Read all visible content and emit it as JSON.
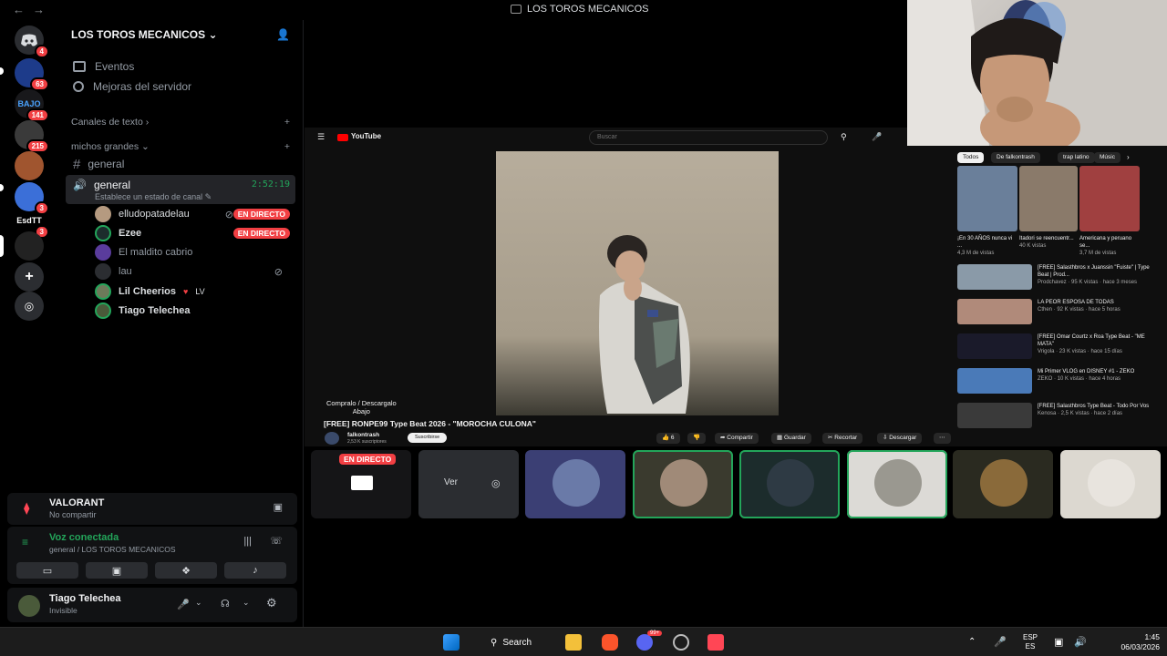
{
  "window": {
    "title": "LOS TOROS MECANICOS"
  },
  "rail": {
    "servers": [
      {
        "name": "discord-home-icon",
        "badge": "4"
      },
      {
        "name": "server-1",
        "badge": "63"
      },
      {
        "name": "server-bajo",
        "label": "BAJO",
        "badge": "141"
      },
      {
        "name": "server-3",
        "badge": "215"
      },
      {
        "name": "server-4",
        "badge": ""
      },
      {
        "name": "server-5",
        "badge": "3"
      },
      {
        "name": "server-esdtt",
        "label": "EsdTT",
        "badge": "3"
      },
      {
        "name": "server-toros",
        "badge": ""
      }
    ]
  },
  "sidebar": {
    "server_name": "LOS TOROS MECANICOS",
    "events": "Eventos",
    "boosts": "Mejoras del servidor",
    "category_text": "Canales de texto",
    "category_voice": "michos grandes",
    "text_channel": "general",
    "voice_channel": "general",
    "voice_timer": "2:52:19",
    "voice_status": "Establece un estado de canal",
    "users": [
      {
        "name": "elludopatadelau",
        "live": "EN DIRECTO"
      },
      {
        "name": "Ezee",
        "live": "EN DIRECTO"
      },
      {
        "name": "El maldito cabrio",
        "live": ""
      },
      {
        "name": "lau",
        "live": ""
      },
      {
        "name": "Lil Cheerios",
        "live": "",
        "extra": "LV"
      },
      {
        "name": "Tiago Telechea",
        "live": ""
      }
    ]
  },
  "activity": {
    "game": "VALORANT",
    "status": "No compartir"
  },
  "voice": {
    "state": "Voz conectada",
    "location": "general / LOS TOROS MECANICOS"
  },
  "account": {
    "name": "Tiago Telechea",
    "status": "Invisible"
  },
  "youtube": {
    "logo": "YouTube",
    "search_placeholder": "Buscar",
    "chips": [
      "Todos",
      "De falkontrash",
      "trap latino",
      "Músic"
    ],
    "overlay_text": "Compralo / Descargalo\nAbajo",
    "video_title": "[FREE] RONPE99 Type Beat 2026 - \"MOROCHA CULONA\"",
    "channel": "falkontrash",
    "subs": "2,53 K suscriptores",
    "subscribe": "Suscribirse",
    "likes": "6",
    "actions": [
      "Compartir",
      "Guardar",
      "Recortar",
      "Descargar"
    ],
    "shorts": [
      {
        "title": "¡En 30 AÑOS nunca vi ...",
        "meta": "4,3 M de vistas"
      },
      {
        "title": "Itadori se reencuentr...",
        "meta": "40 K vistas"
      },
      {
        "title": "Americana y peruano se...",
        "meta": "3,7 M de vistas"
      }
    ],
    "recs": [
      {
        "title": "[FREE] Salasthbros x Juanssin \"Fuiste\" | Type Beat | Prod...",
        "meta": "Prodchavez · 95 K vistas · hace 3 meses",
        "dur": "2:16"
      },
      {
        "title": "LA PEOR ESPOSA DE TODAS",
        "meta": "Cthen · 92 K vistas · hace 5 horas",
        "dur": "18:32"
      },
      {
        "title": "[FREE] Omar Courtz x Roa Type Beat - \"ME MATA\"",
        "meta": "Vrigola · 23 K vistas · hace 15 días",
        "dur": "2:56"
      },
      {
        "title": "Mi Primer VLOG en DISNEY #1 - ZEKO",
        "meta": "ZEKO · 10 K vistas · hace 4 horas",
        "dur": "16:07"
      },
      {
        "title": "[FREE] Salasthbros Type Beat - Todo Por Vos",
        "meta": "Kenosa · 2,5 K vistas · hace 2 días",
        "dur": "2:11"
      }
    ]
  },
  "tiles": {
    "live_badge": "EN DIRECTO",
    "view_button": "Ver"
  },
  "taskbar": {
    "search": "Search",
    "lang_top": "ESP",
    "lang_bottom": "ES",
    "time": "1:45",
    "date": "06/03/2026",
    "discord_badge": "99+"
  },
  "colors": {
    "accent_green": "#23a55a",
    "live_red": "#f23f43",
    "bg": "#000000"
  }
}
